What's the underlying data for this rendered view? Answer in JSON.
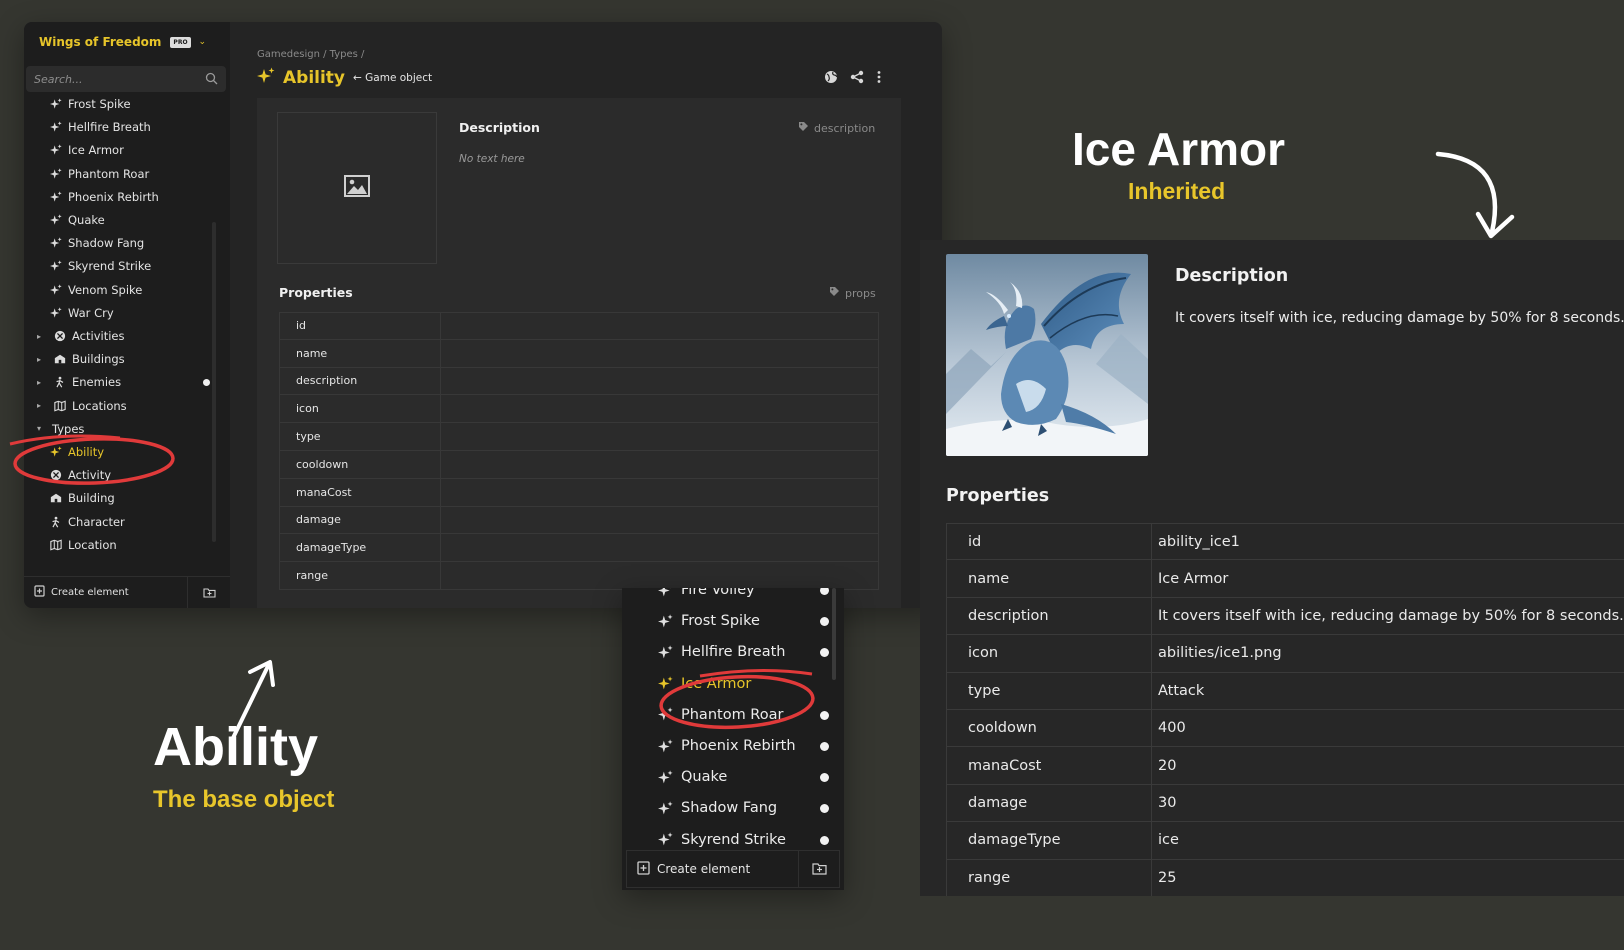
{
  "project": {
    "name": "Wings of Freedom",
    "badge": "PRO"
  },
  "search": {
    "placeholder": "Search..."
  },
  "sidebar": {
    "items": [
      {
        "label": "Frost Spike",
        "icon": "sparkle-icon",
        "level": 2
      },
      {
        "label": "Hellfire Breath",
        "icon": "sparkle-icon",
        "level": 2
      },
      {
        "label": "Ice Armor",
        "icon": "sparkle-icon",
        "level": 2
      },
      {
        "label": "Phantom Roar",
        "icon": "sparkle-icon",
        "level": 2
      },
      {
        "label": "Phoenix Rebirth",
        "icon": "sparkle-icon",
        "level": 2
      },
      {
        "label": "Quake",
        "icon": "sparkle-icon",
        "level": 2
      },
      {
        "label": "Shadow Fang",
        "icon": "sparkle-icon",
        "level": 2
      },
      {
        "label": "Skyrend Strike",
        "icon": "sparkle-icon",
        "level": 2
      },
      {
        "label": "Venom Spike",
        "icon": "sparkle-icon",
        "level": 2
      },
      {
        "label": "War Cry",
        "icon": "sparkle-icon",
        "level": 2
      },
      {
        "label": "Activities",
        "icon": "activity-icon",
        "level": 1,
        "caret": "right"
      },
      {
        "label": "Buildings",
        "icon": "building-icon",
        "level": 1,
        "caret": "right"
      },
      {
        "label": "Enemies",
        "icon": "character-icon",
        "level": 1,
        "caret": "right",
        "dot": true
      },
      {
        "label": "Locations",
        "icon": "map-icon",
        "level": 1,
        "caret": "right"
      },
      {
        "label": "Types",
        "icon": "",
        "level": 1,
        "caret": "down"
      },
      {
        "label": "Ability",
        "icon": "sparkle-icon",
        "level": 2,
        "selected": true
      },
      {
        "label": "Activity",
        "icon": "activity-icon",
        "level": 2
      },
      {
        "label": "Building",
        "icon": "building-icon",
        "level": 2
      },
      {
        "label": "Character",
        "icon": "character-icon",
        "level": 2
      },
      {
        "label": "Location",
        "icon": "map-icon",
        "level": 2
      }
    ],
    "create_label": "Create element"
  },
  "editor": {
    "breadcrumb": "Gamedesign / Types /",
    "title": "Ability",
    "parent": "← Game object",
    "description_title": "Description",
    "description_tag": "description",
    "description_empty": "No text here",
    "properties_title": "Properties",
    "properties_tag": "props",
    "property_keys": [
      "id",
      "name",
      "description",
      "icon",
      "type",
      "cooldown",
      "manaCost",
      "damage",
      "damageType",
      "range"
    ]
  },
  "annotations": {
    "ability_title": "Ability",
    "ability_subtitle": "The base object",
    "ice_title": "Ice Armor",
    "ice_subtitle": "Inherited"
  },
  "mid_list": {
    "items": [
      {
        "label": "Fire Volley",
        "dot": true
      },
      {
        "label": "Frost Spike",
        "dot": true
      },
      {
        "label": "Hellfire Breath",
        "dot": true
      },
      {
        "label": "Ice Armor",
        "dot": false,
        "selected": true
      },
      {
        "label": "Phantom Roar",
        "dot": true
      },
      {
        "label": "Phoenix Rebirth",
        "dot": true
      },
      {
        "label": "Quake",
        "dot": true
      },
      {
        "label": "Shadow Fang",
        "dot": true
      },
      {
        "label": "Skyrend Strike",
        "dot": true
      }
    ],
    "create_label": "Create element"
  },
  "detail": {
    "description_title": "Description",
    "description_text": "It covers itself with ice, reducing damage by 50% for 8 seconds.",
    "properties_title": "Properties",
    "properties": [
      {
        "key": "id",
        "value": "ability_ice1"
      },
      {
        "key": "name",
        "value": "Ice Armor"
      },
      {
        "key": "description",
        "value": "It covers itself with ice, reducing damage by 50% for 8 seconds."
      },
      {
        "key": "icon",
        "value": "abilities/ice1.png"
      },
      {
        "key": "type",
        "value": "Attack"
      },
      {
        "key": "cooldown",
        "value": "400"
      },
      {
        "key": "manaCost",
        "value": "20"
      },
      {
        "key": "damage",
        "value": "30"
      },
      {
        "key": "damageType",
        "value": "ice"
      },
      {
        "key": "range",
        "value": "25"
      }
    ]
  },
  "colors": {
    "accent": "#e7c52a",
    "highlight_circle": "#e03a3a",
    "background": "#353630"
  }
}
